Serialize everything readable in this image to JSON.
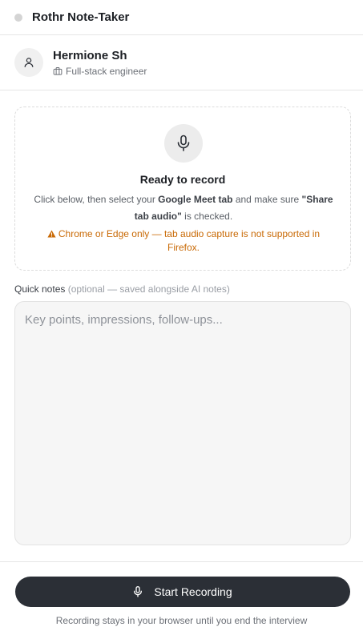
{
  "header": {
    "title": "Rothr Note-Taker"
  },
  "candidate": {
    "name": "Hermione Sh",
    "role": "Full-stack engineer",
    "avatar_icon": "user-icon",
    "role_icon": "briefcase-icon"
  },
  "record_card": {
    "icon": "microphone-icon",
    "title": "Ready to record",
    "instruction_1": "Click below, then select your ",
    "instruction_bold_1": "Google Meet tab",
    "instruction_2": " and make sure ",
    "instruction_bold_2": "\"Share tab audio\"",
    "instruction_3": " is checked.",
    "warning_icon": "warning-icon",
    "warning": "Chrome or Edge only — tab audio capture is not supported in Firefox."
  },
  "notes": {
    "label": "Quick notes",
    "label_hint": "(optional — saved alongside AI notes)",
    "placeholder": "Key points, impressions, follow-ups...",
    "value": ""
  },
  "footer": {
    "button_label": "Start Recording",
    "button_icon": "microphone-icon",
    "footnote": "Recording stays in your browser until you end the interview"
  },
  "colors": {
    "accent_dark": "#2b2f36",
    "warning": "#c96a06",
    "status_dot": "#d4d4d4"
  }
}
